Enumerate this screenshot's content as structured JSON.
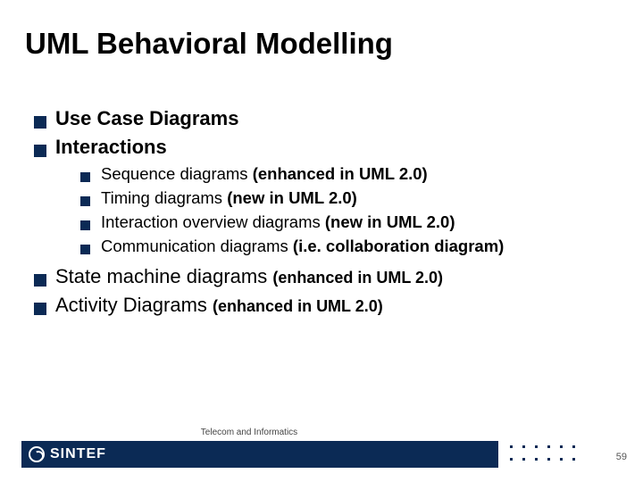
{
  "title": "UML Behavioral Modelling",
  "bullets": {
    "b1": {
      "text": "Use Case Diagrams"
    },
    "b2": {
      "text": "Interactions"
    },
    "sub": {
      "s1": {
        "text": "Sequence diagrams ",
        "note": "(enhanced in UML 2.0)"
      },
      "s2": {
        "text": "Timing diagrams ",
        "note": "(new in UML 2.0)"
      },
      "s3": {
        "text": "Interaction overview diagrams ",
        "note": "(new in UML 2.0)"
      },
      "s4": {
        "text": "Communication diagrams ",
        "note": "(i.e. collaboration diagram)"
      }
    },
    "b3": {
      "text": "State machine diagrams ",
      "note": "(enhanced in UML 2.0)"
    },
    "b4": {
      "text": "Activity Diagrams ",
      "note": "(enhanced in UML 2.0)"
    }
  },
  "footer": {
    "brand": "SINTEF",
    "caption": "Telecom and Informatics",
    "page": "59"
  }
}
